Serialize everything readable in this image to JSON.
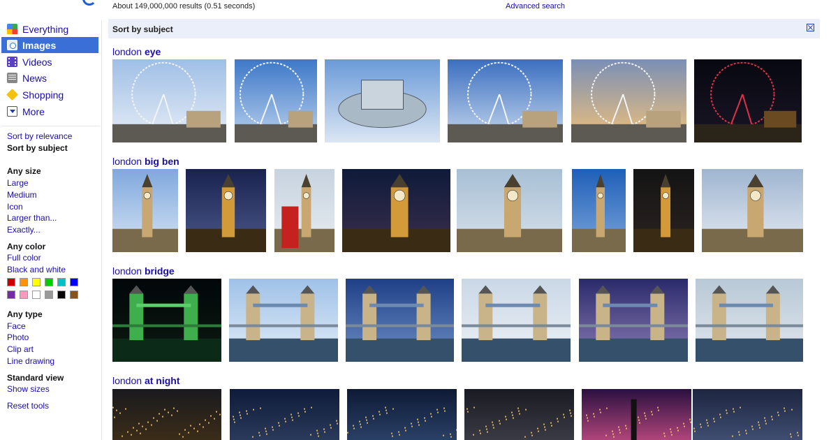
{
  "header": {
    "results_stats": "About 149,000,000 results (0.51 seconds)",
    "advanced_search": "Advanced search"
  },
  "sidebar": {
    "nav": [
      {
        "label": "Everything",
        "icon": "everything-icon"
      },
      {
        "label": "Images",
        "icon": "images-icon",
        "selected": true
      },
      {
        "label": "Videos",
        "icon": "videos-icon"
      },
      {
        "label": "News",
        "icon": "news-icon"
      },
      {
        "label": "Shopping",
        "icon": "shopping-icon"
      },
      {
        "label": "More",
        "icon": "more-icon"
      }
    ],
    "sort": {
      "relevance": "Sort by relevance",
      "subject": "Sort by subject"
    },
    "size": {
      "heading": "Any size",
      "options": [
        "Large",
        "Medium",
        "Icon",
        "Larger than...",
        "Exactly..."
      ]
    },
    "color": {
      "heading": "Any color",
      "options": [
        "Full color",
        "Black and white"
      ],
      "swatches_row1": [
        "#cc0000",
        "#fb940b",
        "#ffff00",
        "#00cc00",
        "#03c0c6",
        "#0000ff"
      ],
      "swatches_row2": [
        "#762ca7",
        "#ff98bf",
        "#ffffff",
        "#999999",
        "#000000",
        "#885418"
      ]
    },
    "type": {
      "heading": "Any type",
      "options": [
        "Face",
        "Photo",
        "Clip art",
        "Line drawing"
      ]
    },
    "view": {
      "heading": "Standard view",
      "show_sizes": "Show sizes"
    },
    "reset": "Reset tools"
  },
  "main": {
    "sort_header": "Sort by subject",
    "groups": [
      {
        "prefix": "london ",
        "term": "eye"
      },
      {
        "prefix": "london ",
        "term": "big ben"
      },
      {
        "prefix": "london ",
        "term": "bridge"
      },
      {
        "prefix": "london ",
        "term": "at night"
      }
    ]
  }
}
